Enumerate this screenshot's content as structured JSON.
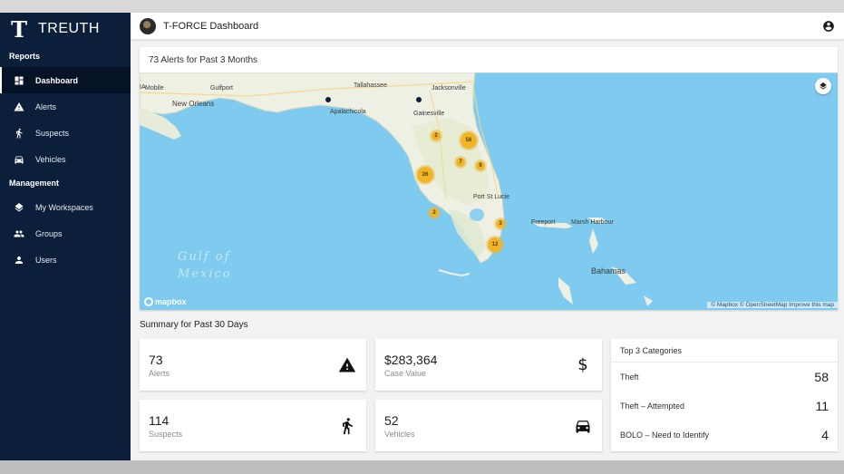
{
  "app": {
    "name": "TREUTH"
  },
  "sidebar": {
    "sections": [
      {
        "label": "Reports"
      },
      {
        "label": "Management"
      }
    ],
    "reports": [
      {
        "label": "Dashboard",
        "icon": "dashboard-icon",
        "active": true
      },
      {
        "label": "Alerts",
        "icon": "warning-icon"
      },
      {
        "label": "Suspects",
        "icon": "running-person-icon"
      },
      {
        "label": "Vehicles",
        "icon": "car-icon"
      }
    ],
    "management": [
      {
        "label": "My Workspaces",
        "icon": "layers-icon"
      },
      {
        "label": "Groups",
        "icon": "groups-icon"
      },
      {
        "label": "Users",
        "icon": "person-icon"
      }
    ]
  },
  "topbar": {
    "title": "T-FORCE Dashboard",
    "account_icon": "account-circle-icon"
  },
  "map": {
    "title": "73 Alerts for Past 3 Months",
    "gulf_label_1": "Gulf of",
    "gulf_label_2": "Mexico",
    "logo": "mapbox",
    "attribution": "© Mapbox © OpenStreetMap Improve this map",
    "places": {
      "a": "Mobile",
      "b": "Gulfport",
      "c": "New Orleans",
      "d": "Tallahassee",
      "e": "Jacksonville",
      "f": "Apalachicola",
      "g": "Gainesville",
      "h": "Port St Lucie",
      "i": "Freeport",
      "j": "Marsh Harbour",
      "k": "Bahamas",
      "l": "IA"
    },
    "clusters": [
      "2",
      "56",
      "7",
      "9",
      "26",
      "2",
      "3",
      "12"
    ]
  },
  "summary": {
    "title": "Summary for Past 30 Days",
    "alerts": {
      "value": "73",
      "label": "Alerts",
      "icon": "warning-icon"
    },
    "case_value": {
      "value": "$283,364",
      "label": "Case Value",
      "icon": "dollar-icon"
    },
    "suspects": {
      "value": "114",
      "label": "Suspects",
      "icon": "running-person-icon"
    },
    "vehicles": {
      "value": "52",
      "label": "Vehicles",
      "icon": "car-icon"
    },
    "top3": {
      "title": "Top 3 Categories",
      "rows": [
        {
          "name": "Theft",
          "count": "58"
        },
        {
          "name": "Theft – Attempted",
          "count": "11"
        },
        {
          "name": "BOLO – Need to Identify",
          "count": "4"
        }
      ]
    }
  },
  "colors": {
    "sidebar": "#0b1f3a",
    "water": "#7ecbef",
    "land": "#eef0e4",
    "cluster": "#f0b429"
  }
}
